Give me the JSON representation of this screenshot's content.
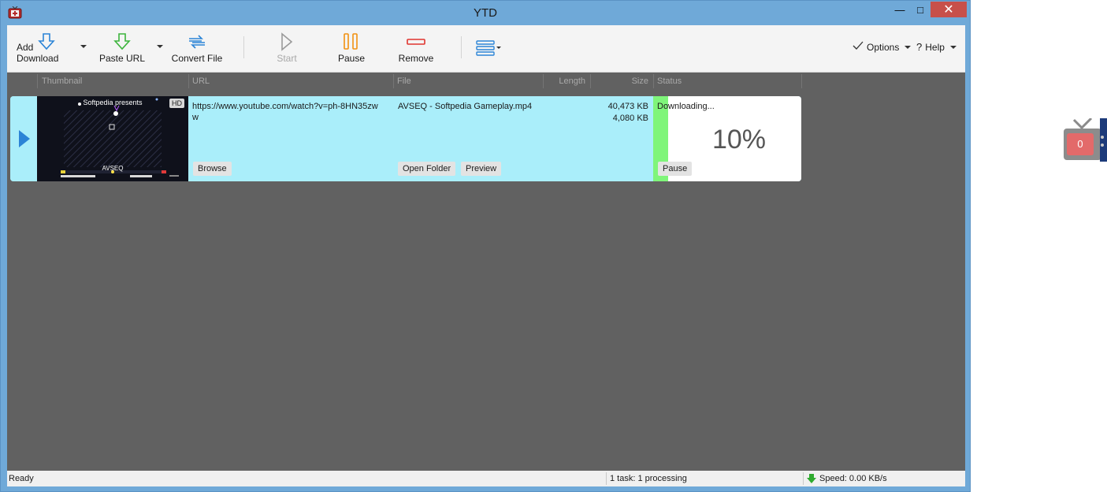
{
  "window": {
    "title": "YTD",
    "controls": {
      "minimize": "—",
      "maximize": "□",
      "close": "✕"
    }
  },
  "toolbar": {
    "add_download": "Add Download",
    "paste_url": "Paste URL",
    "convert_file": "Convert File",
    "start": "Start",
    "pause": "Pause",
    "remove": "Remove",
    "options": "Options",
    "help": "Help"
  },
  "columns": {
    "thumbnail": "Thumbnail",
    "url": "URL",
    "file": "File",
    "length": "Length",
    "size": "Size",
    "status": "Status"
  },
  "download": {
    "thumbnail_title": "Softpedia presents",
    "thumbnail_caption": "AVSEQ",
    "hd_badge": "HD",
    "url_line1": "https://www.youtube.com/watch?v=ph-8HN35zw",
    "url_line2": "w",
    "file": "AVSEQ - Softpedia Gameplay.mp4",
    "size_total": "40,473 KB",
    "size_done": "4,080 KB",
    "status": "Downloading...",
    "percent_text": "10%",
    "progress_fraction": 0.1,
    "browse": "Browse",
    "open_folder": "Open Folder",
    "preview": "Preview",
    "pause": "Pause"
  },
  "statusbar": {
    "state": "Ready",
    "tasks": "1 task: 1 processing",
    "speed": "Speed: 0.00 KB/s"
  },
  "floating_widget": {
    "count": "0"
  },
  "colors": {
    "window_frame": "#6fa9d8",
    "list_bg": "#616161",
    "row_bg": "#aaeefa",
    "progress": "#7ff57a",
    "close_button": "#c7504a",
    "badge": "#e36a6a"
  }
}
